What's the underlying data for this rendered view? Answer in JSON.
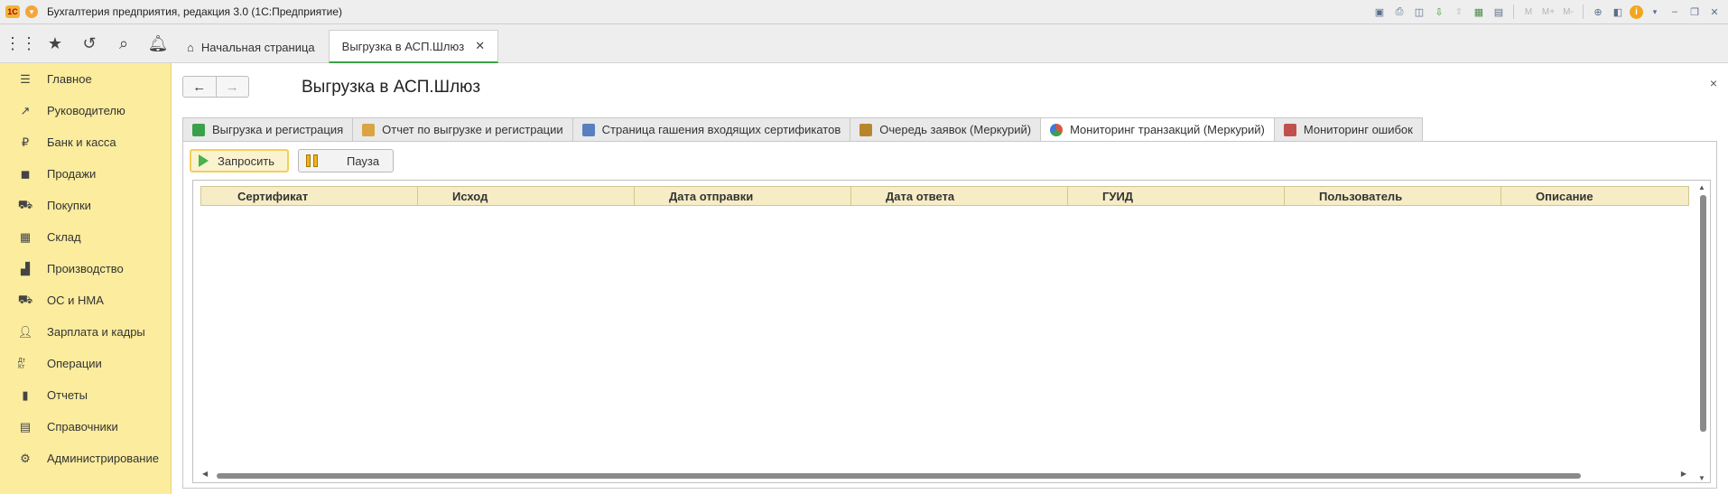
{
  "app": {
    "title": "Бухгалтерия предприятия, редакция 3.0  (1С:Предприятие)",
    "logo_text": "1С"
  },
  "titlebar_icons": [
    "save-icon",
    "print-icon",
    "preview-icon",
    "import-icon",
    "export-icon",
    "table-icon",
    "calendar-icon",
    "m-icon",
    "m-plus-icon",
    "m-minus-icon",
    "zoom-icon",
    "panels-icon",
    "info-icon",
    "minimize-icon",
    "restore-icon",
    "close-icon"
  ],
  "titlebar_labels": {
    "m": "M",
    "m_plus": "M+",
    "m_minus": "M-"
  },
  "top_tabs": [
    {
      "label": "Начальная страница",
      "icon": "home-icon"
    },
    {
      "label": "Выгрузка в АСП.Шлюз",
      "active": true
    }
  ],
  "sidebar": {
    "items": [
      {
        "label": "Главное",
        "icon": "menu-icon"
      },
      {
        "label": "Руководителю",
        "icon": "trend-icon"
      },
      {
        "label": "Банк и касса",
        "icon": "coin-icon"
      },
      {
        "label": "Продажи",
        "icon": "bag-icon"
      },
      {
        "label": "Покупки",
        "icon": "cart-icon"
      },
      {
        "label": "Склад",
        "icon": "warehouse-icon"
      },
      {
        "label": "Производство",
        "icon": "factory-icon"
      },
      {
        "label": "ОС и НМА",
        "icon": "truck-icon"
      },
      {
        "label": "Зарплата и кадры",
        "icon": "person-icon"
      },
      {
        "label": "Операции",
        "icon": "dt-kt-icon",
        "icon_text": "Дт Кт"
      },
      {
        "label": "Отчеты",
        "icon": "bar-chart-icon"
      },
      {
        "label": "Справочники",
        "icon": "book-icon"
      },
      {
        "label": "Администрирование",
        "icon": "gear-icon"
      }
    ]
  },
  "page": {
    "title": "Выгрузка в АСП.Шлюз",
    "back": "←",
    "forward": "→",
    "close": "×"
  },
  "form_tabs": [
    {
      "label": "Выгрузка и регистрация",
      "icon": "upload-icon",
      "color": "#3aa14a"
    },
    {
      "label": "Отчет по выгрузке и регистрации",
      "icon": "report-icon",
      "color": "#d9a441"
    },
    {
      "label": "Страница гашения входящих сертификатов",
      "icon": "puzzle-icon",
      "color": "#5a7fbf"
    },
    {
      "label": "Очередь заявок (Меркурий)",
      "icon": "queue-icon",
      "color": "#b8862a"
    },
    {
      "label": "Мониторинг транзакций (Меркурий)",
      "icon": "pie-icon",
      "color": "#e0533c",
      "active": true
    },
    {
      "label": "Мониторинг ошибок",
      "icon": "monitor-icon",
      "color": "#c0504d"
    }
  ],
  "buttons": {
    "request": "Запросить",
    "pause": "Пауза"
  },
  "table": {
    "columns": [
      "Сертификат",
      "Исход",
      "Дата отправки",
      "Дата ответа",
      "ГУИД",
      "Пользователь",
      "Описание"
    ],
    "rows": []
  }
}
